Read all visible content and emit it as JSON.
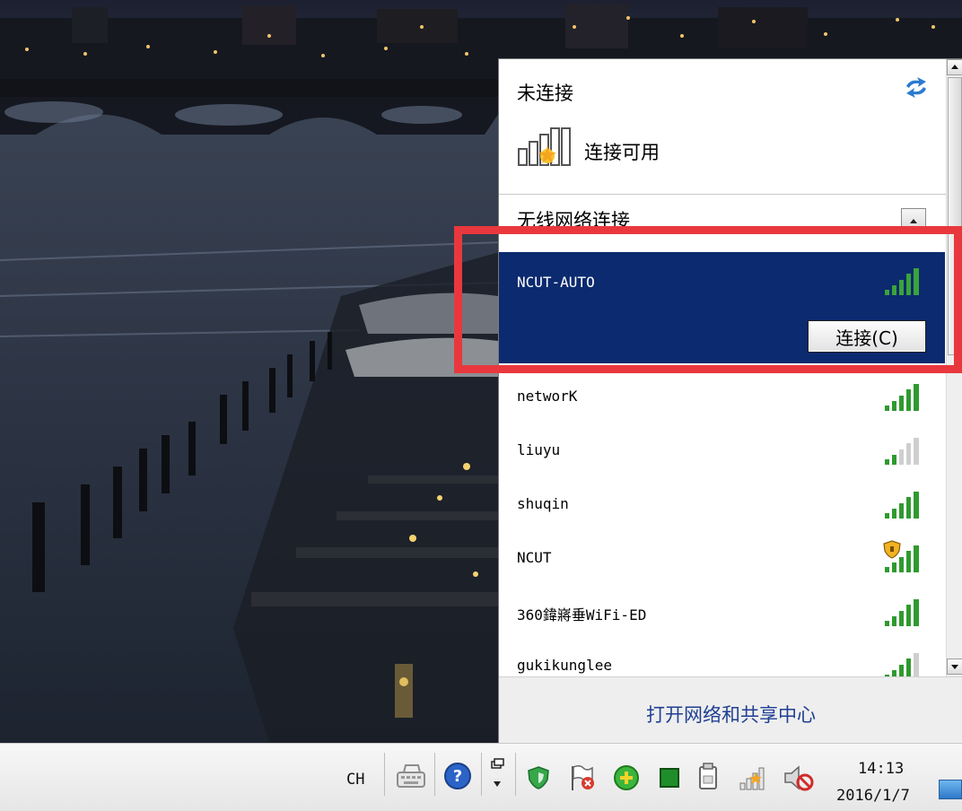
{
  "panel": {
    "status_title": "未连接",
    "available_label": "连接可用",
    "section_title": "无线网络连接",
    "selected_network": {
      "ssid": "NCUT-AUTO",
      "connect_label": "连接(C)"
    },
    "networks": [
      {
        "ssid": "networK",
        "signal_bars": 5,
        "secured": false
      },
      {
        "ssid": "liuyu",
        "signal_bars": 2,
        "secured": false
      },
      {
        "ssid": "shuqin",
        "signal_bars": 5,
        "secured": false
      },
      {
        "ssid": "NCUT",
        "signal_bars": 5,
        "secured": true
      },
      {
        "ssid": "360鍏嶈垂WiFi-ED",
        "signal_bars": 5,
        "secured": false
      },
      {
        "ssid": "gukikunglee",
        "signal_bars": 4,
        "secured": false
      }
    ],
    "footer_link": "打开网络和共享中心"
  },
  "taskbar": {
    "language": "CH",
    "clock_time": "14:13",
    "clock_date": "2016/1/7"
  },
  "colors": {
    "selection_bg": "#0b2a6f",
    "signal_green": "#2f9a2f",
    "highlight_red": "#e9383d",
    "link_blue": "#1f3f91"
  },
  "icons": {
    "refresh": "refresh-arrows-icon",
    "available": "signal-star-icon",
    "signal": "wifi-signal-bars-icon",
    "secured": "security-shield-icon"
  }
}
